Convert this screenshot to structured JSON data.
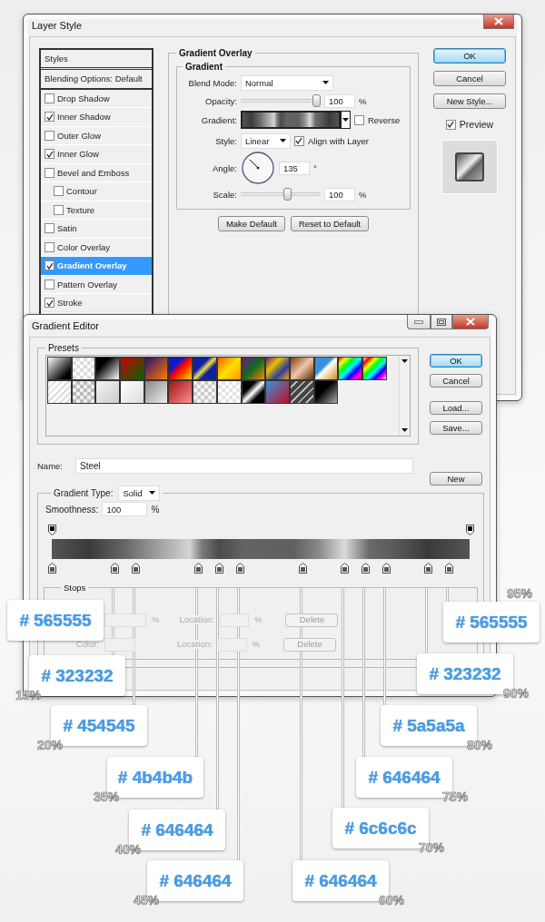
{
  "layer_style": {
    "title": "Layer Style",
    "styles_header": "Styles",
    "styles": [
      {
        "label": "Blending Options: Default",
        "kind": "header",
        "selected": false
      },
      {
        "label": "Drop Shadow",
        "kind": "effect",
        "checked": false,
        "selected": false
      },
      {
        "label": "Inner Shadow",
        "kind": "effect",
        "checked": true,
        "selected": false
      },
      {
        "label": "Outer Glow",
        "kind": "effect",
        "checked": false,
        "selected": false
      },
      {
        "label": "Inner Glow",
        "kind": "effect",
        "checked": true,
        "selected": false
      },
      {
        "label": "Bevel and Emboss",
        "kind": "effect",
        "checked": false,
        "selected": false
      },
      {
        "label": "Contour",
        "kind": "sub",
        "checked": false,
        "selected": false
      },
      {
        "label": "Texture",
        "kind": "sub",
        "checked": false,
        "selected": false
      },
      {
        "label": "Satin",
        "kind": "effect",
        "checked": false,
        "selected": false
      },
      {
        "label": "Color Overlay",
        "kind": "effect",
        "checked": false,
        "selected": false
      },
      {
        "label": "Gradient Overlay",
        "kind": "effect",
        "checked": true,
        "selected": true
      },
      {
        "label": "Pattern Overlay",
        "kind": "effect",
        "checked": false,
        "selected": false
      },
      {
        "label": "Stroke",
        "kind": "effect",
        "checked": true,
        "selected": false
      }
    ],
    "group_title": "Gradient Overlay",
    "subgroup_title": "Gradient",
    "blend_mode": {
      "label": "Blend Mode:",
      "value": "Normal"
    },
    "opacity": {
      "label": "Opacity:",
      "level": 1,
      "value": "100",
      "unit": "%"
    },
    "gradient": {
      "label": "Gradient:"
    },
    "reverse": {
      "label": "Reverse",
      "checked": false
    },
    "style": {
      "label": "Style:",
      "value": "Linear"
    },
    "align": {
      "label": "Align with Layer",
      "checked": true
    },
    "angle": {
      "label": "Angle:",
      "value": "135",
      "unit": "°"
    },
    "scale": {
      "label": "Scale:",
      "level": 0.6,
      "value": "100",
      "unit": "%"
    },
    "buttons": [
      "Make Default",
      "Reset to Default"
    ],
    "side_buttons": [
      {
        "label": "OK",
        "default": true
      },
      {
        "label": "Cancel",
        "default": false
      },
      {
        "label": "New Style...",
        "default": false
      }
    ],
    "preview": {
      "label": "Preview",
      "checked": true
    }
  },
  "gradient_editor": {
    "title": "Gradient Editor",
    "presets_title": "Presets",
    "buttons": [
      {
        "label": "OK",
        "default": true
      },
      {
        "label": "Cancel",
        "default": false
      },
      {
        "label": "Load...",
        "default": false
      },
      {
        "label": "Save...",
        "default": false
      }
    ],
    "name": {
      "label": "Name:",
      "value": "Steel"
    },
    "new_button": "New",
    "gradient_type": {
      "label": "Gradient Type:",
      "value": "Solid"
    },
    "smoothness": {
      "label": "Smoothness:",
      "value": "100",
      "unit": "%"
    },
    "stops_title": "Stops",
    "stop_rows": [
      {
        "unit": "%",
        "location_label": "Location:",
        "location_unit": "%",
        "delete": "Delete",
        "disabled": true
      },
      {
        "label": "Color:",
        "location_label": "Location:",
        "location_unit": "%",
        "delete": "Delete",
        "disabled": true
      }
    ]
  },
  "callouts": [
    {
      "code": "# 565555"
    },
    {
      "code": "# 323232",
      "percent": "15%"
    },
    {
      "code": "# 454545",
      "percent": "20%"
    },
    {
      "code": "# 4b4b4b",
      "percent": "35%"
    },
    {
      "code": "# 646464",
      "percent": "40%"
    },
    {
      "code": "# 646464",
      "percent": "45%"
    },
    {
      "code": "# 565555",
      "percent": "95%"
    },
    {
      "code": "# 323232",
      "percent": "90%"
    },
    {
      "code": "# 5a5a5a",
      "percent": "80%"
    },
    {
      "code": "# 646464",
      "percent": "75%"
    },
    {
      "code": "# 6c6c6c",
      "percent": "70%"
    },
    {
      "code": "# 646464",
      "percent": "60%"
    }
  ]
}
